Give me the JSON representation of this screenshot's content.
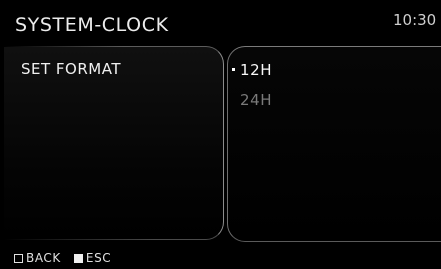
{
  "header": {
    "title": "SYSTEM-CLOCK",
    "time": "10:30"
  },
  "menu": {
    "current_item": "SET FORMAT"
  },
  "options": {
    "items": [
      {
        "label": "12H",
        "selected": true
      },
      {
        "label": "24H",
        "selected": false
      }
    ]
  },
  "footer": {
    "back_label": "BACK",
    "esc_label": "ESC",
    "back_icon": "hollow-square-icon",
    "esc_icon": "filled-square-icon"
  },
  "colors": {
    "background": "#000000",
    "text": "#ececec",
    "unselected": "#7a7a7a"
  }
}
